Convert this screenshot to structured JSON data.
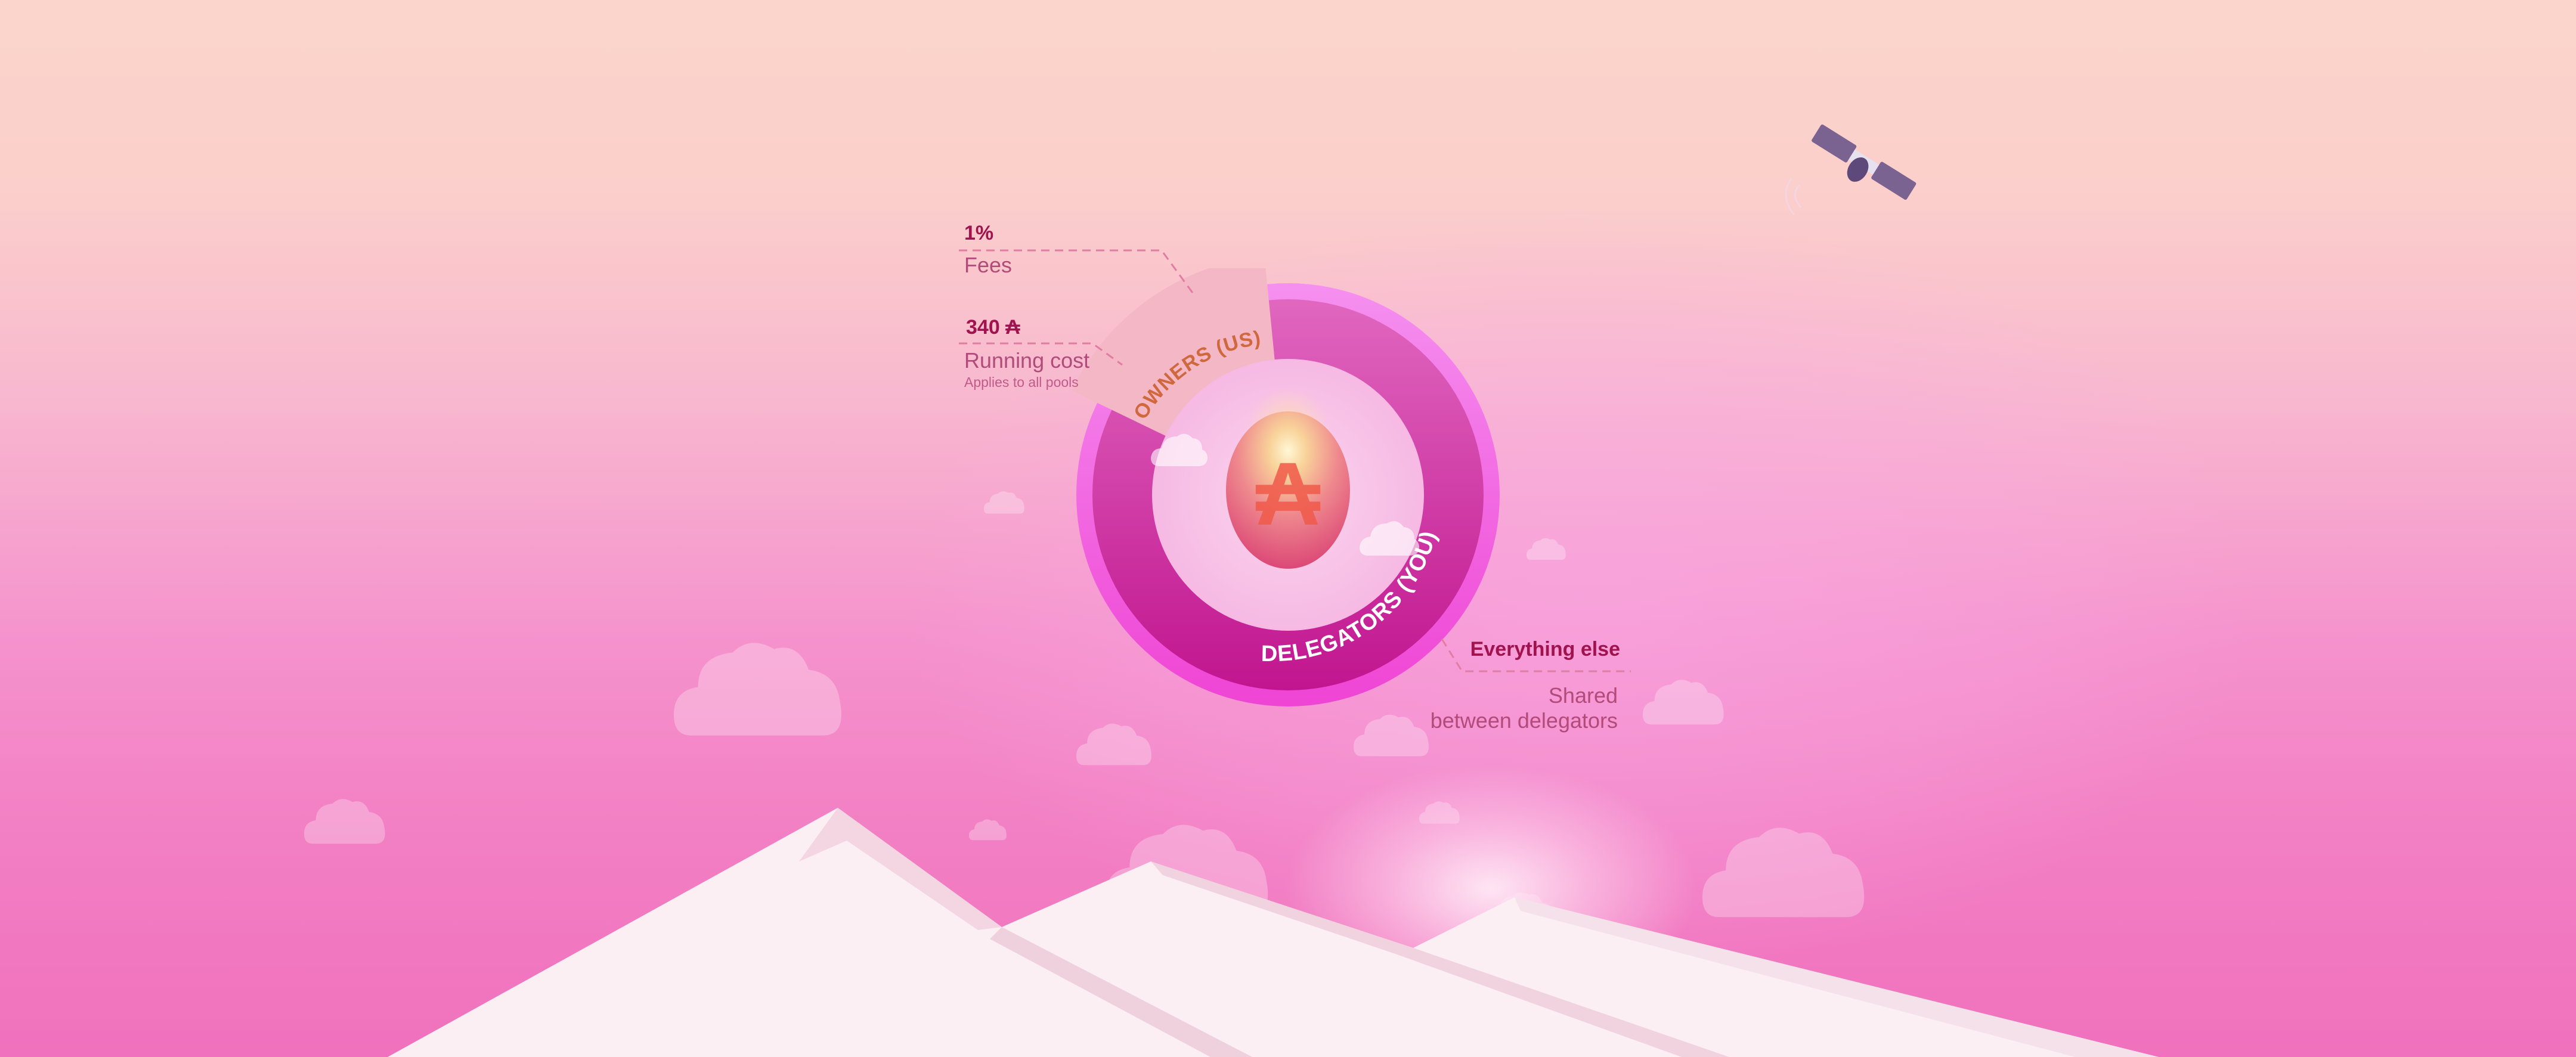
{
  "diagram": {
    "owners_label": "OWNERS (US)",
    "delegators_label": "DELEGATORS (YOU)",
    "center_symbol": "₳"
  },
  "annotations": {
    "fees": {
      "value": "1%",
      "label": "Fees"
    },
    "running_cost": {
      "value": "340 ₳",
      "label": "Running cost",
      "note": "Applies to all pools"
    },
    "everything_else": {
      "value": "Everything else",
      "label_line1": "Shared",
      "label_line2": "between delegators"
    }
  },
  "colors": {
    "ring_outer": "#f06ae6",
    "delegators_dark": "#c31493",
    "delegators_light": "#df5bbe",
    "owners": "#f5b6c8",
    "accent_text": "#a0134e"
  }
}
